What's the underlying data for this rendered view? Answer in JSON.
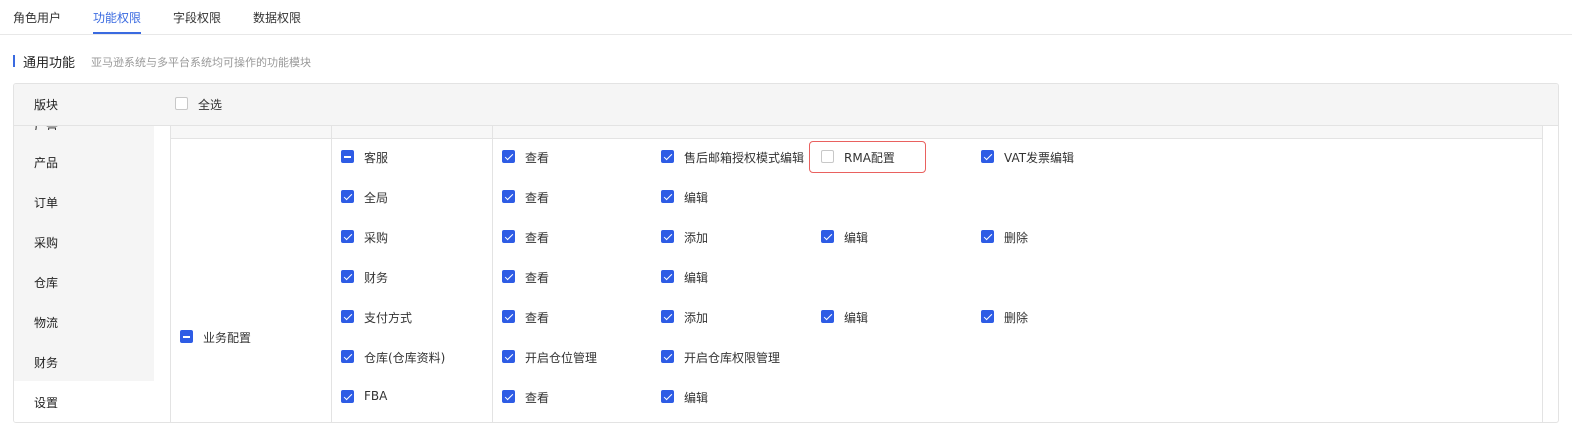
{
  "tabs": [
    {
      "label": "角色用户",
      "active": false
    },
    {
      "label": "功能权限",
      "active": true
    },
    {
      "label": "字段权限",
      "active": false
    },
    {
      "label": "数据权限",
      "active": false
    }
  ],
  "section": {
    "title": "通用功能",
    "description": "亚马逊系统与多平台系统均可操作的功能模块"
  },
  "panel": {
    "header_label": "版块",
    "select_all_label": "全选",
    "select_all_checked": false
  },
  "sidebar": {
    "partial_item": "广告",
    "items": [
      "产品",
      "订单",
      "采购",
      "仓库",
      "物流",
      "财务",
      "设置"
    ],
    "active": "设置"
  },
  "group": {
    "label": "业务配置",
    "state": "indeterminate"
  },
  "rows": [
    {
      "module": {
        "label": "客服",
        "state": "indeterminate"
      },
      "perms": [
        {
          "label": "查看",
          "checked": true
        },
        {
          "label": "售后邮箱授权模式编辑",
          "checked": true
        },
        {
          "label": "RMA配置",
          "checked": false,
          "highlighted": true
        },
        {
          "label": "VAT发票编辑",
          "checked": true
        }
      ]
    },
    {
      "module": {
        "label": "全局",
        "state": "checked"
      },
      "perms": [
        {
          "label": "查看",
          "checked": true
        },
        {
          "label": "编辑",
          "checked": true
        }
      ]
    },
    {
      "module": {
        "label": "采购",
        "state": "checked"
      },
      "perms": [
        {
          "label": "查看",
          "checked": true
        },
        {
          "label": "添加",
          "checked": true
        },
        {
          "label": "编辑",
          "checked": true
        },
        {
          "label": "删除",
          "checked": true
        }
      ]
    },
    {
      "module": {
        "label": "财务",
        "state": "checked"
      },
      "perms": [
        {
          "label": "查看",
          "checked": true
        },
        {
          "label": "编辑",
          "checked": true
        }
      ]
    },
    {
      "module": {
        "label": "支付方式",
        "state": "checked"
      },
      "perms": [
        {
          "label": "查看",
          "checked": true
        },
        {
          "label": "添加",
          "checked": true
        },
        {
          "label": "编辑",
          "checked": true
        },
        {
          "label": "删除",
          "checked": true
        }
      ]
    },
    {
      "module": {
        "label": "仓库(仓库资料)",
        "state": "checked"
      },
      "perms": [
        {
          "label": "开启仓位管理",
          "checked": true
        },
        {
          "label": "开启仓库权限管理",
          "checked": true
        }
      ]
    },
    {
      "module": {
        "label": "FBA",
        "state": "checked"
      },
      "perms": [
        {
          "label": "查看",
          "checked": true
        },
        {
          "label": "编辑",
          "checked": true
        }
      ]
    }
  ],
  "colors": {
    "accent": "#3a6ae0",
    "checkbox": "#2e5ce5",
    "highlight_border": "#e9615f"
  }
}
